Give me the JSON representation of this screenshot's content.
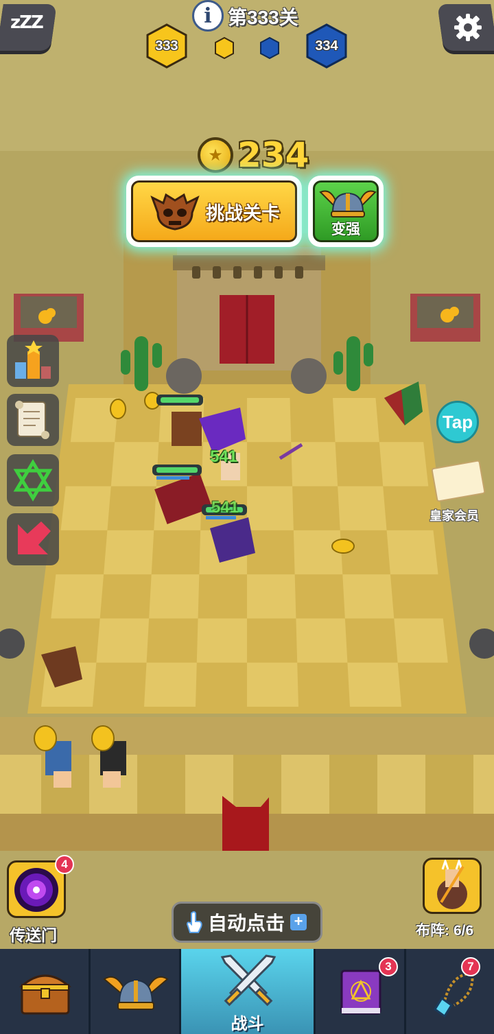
{
  "hud": {
    "level_title": "第333关",
    "current_level": "333",
    "next_level": "334",
    "zzz_label": "zZZ"
  },
  "coins": {
    "count": "234"
  },
  "actions": {
    "challenge_label": "挑战关卡",
    "upgrade_label": "变强"
  },
  "side": {
    "tap_label": "Tap",
    "royal_member_label": "皇家会员"
  },
  "bottom": {
    "portal_label": "传送门",
    "portal_badge": "4",
    "auto_click_label": "自动点击",
    "lineup_label": "布阵:",
    "lineup_value": "6/6"
  },
  "battle": {
    "damage_1": "541",
    "damage_2": "541"
  },
  "nav": {
    "tabs": [
      {
        "name": "chest",
        "label": "",
        "badge": ""
      },
      {
        "name": "hero",
        "label": "",
        "badge": ""
      },
      {
        "name": "battle",
        "label": "战斗",
        "badge": ""
      },
      {
        "name": "spellbook",
        "label": "",
        "badge": "3"
      },
      {
        "name": "necklace",
        "label": "",
        "badge": "7"
      }
    ],
    "active_tab": "battle"
  },
  "colors": {
    "accent_glow": "#7ef6de",
    "challenge_yellow": "#ffd746",
    "upgrade_green": "#3fb52f",
    "badge_red": "#e43454",
    "nav_bg": "#263245",
    "nav_active": "#5ad4ec"
  }
}
